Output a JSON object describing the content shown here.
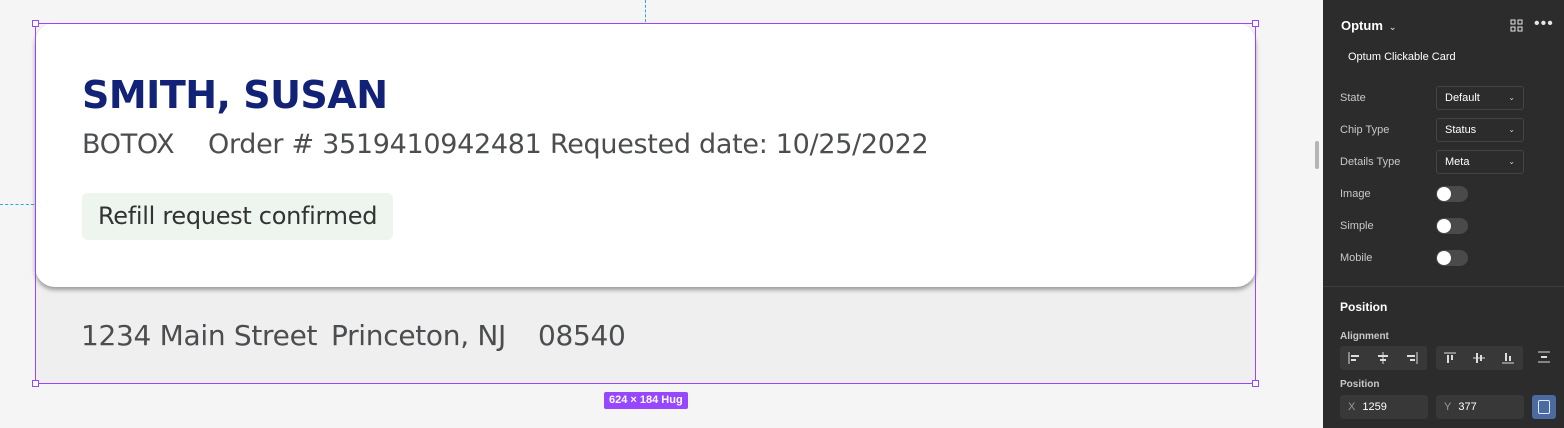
{
  "card": {
    "patient_name": "SMITH, SUSAN",
    "medication": "BOTOX",
    "order": "Order # 3519410942481",
    "requested_date": "Requested date: 10/25/2022",
    "status_chip": "Refill request confirmed"
  },
  "address": {
    "street": "1234 Main Street",
    "city_state": "Princeton, NJ",
    "zip": "08540"
  },
  "selection": {
    "size_badge": "624 × 184 Hug",
    "color": "#9747ff"
  },
  "panel": {
    "library_name": "Optum",
    "component_name": "Optum Clickable Card",
    "properties": [
      {
        "label": "State",
        "value": "Default"
      },
      {
        "label": "Chip Type",
        "value": "Status"
      },
      {
        "label": "Details Type",
        "value": "Meta"
      }
    ],
    "toggles": [
      {
        "label": "Image",
        "on": false
      },
      {
        "label": "Simple",
        "on": false
      },
      {
        "label": "Mobile",
        "on": false
      }
    ],
    "position_title": "Position",
    "alignment_label": "Alignment",
    "position_label": "Position",
    "x_label": "X",
    "x_value": "1259",
    "y_label": "Y",
    "y_value": "377"
  },
  "icons": {
    "library_chevron": "chevron-down-icon",
    "grid": "grid-icon",
    "more": "more-icon"
  }
}
